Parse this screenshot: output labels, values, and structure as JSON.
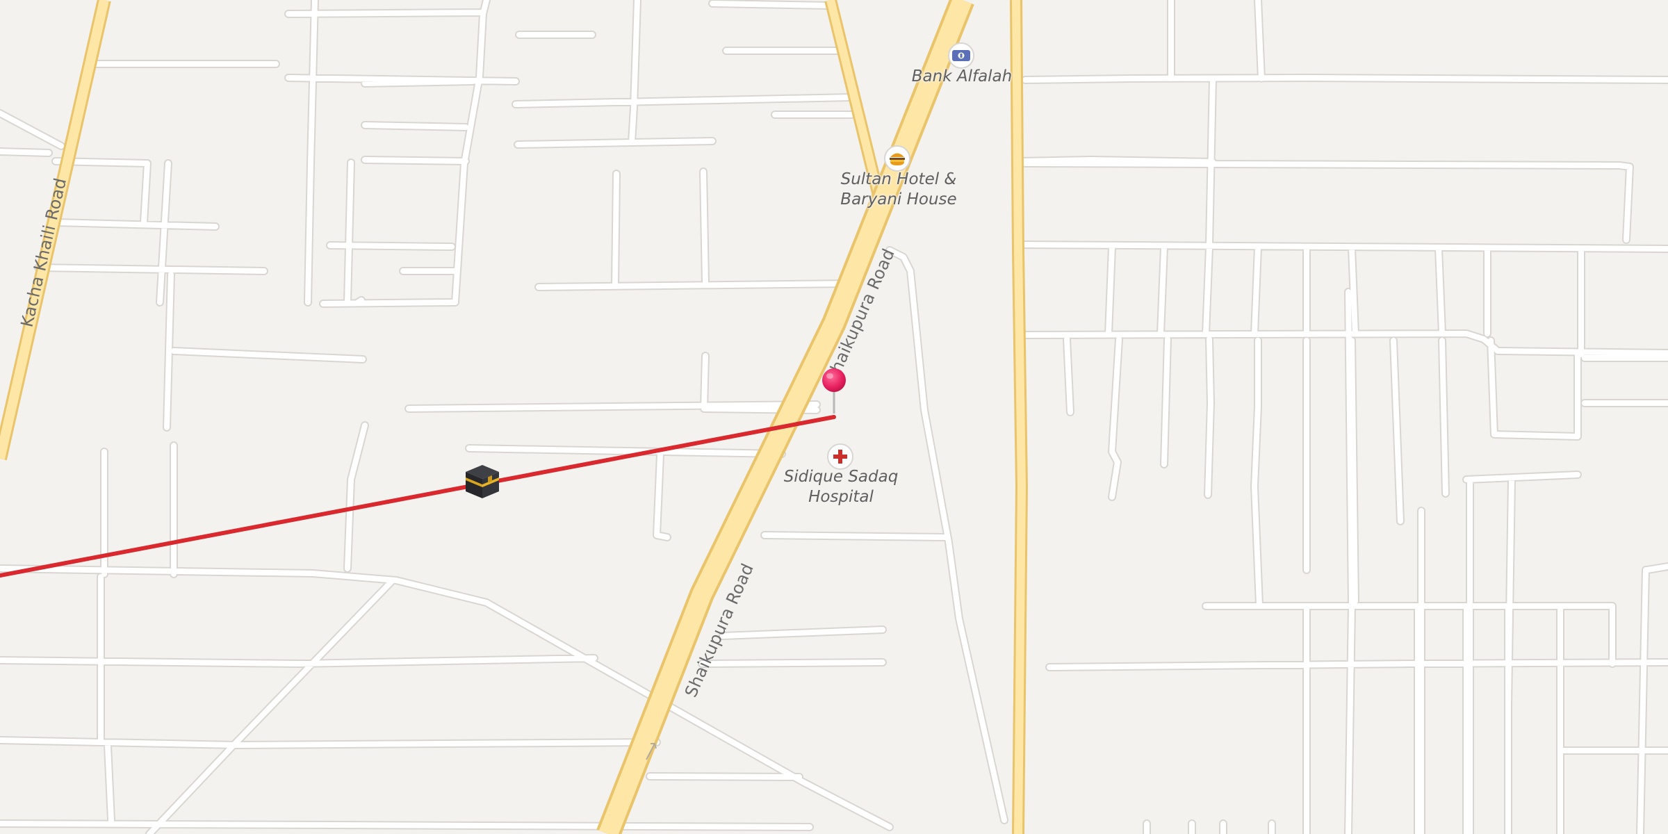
{
  "map": {
    "roads": {
      "kacha_khaili": "Kacha Khaili Road",
      "shaikupura_upper": "Shaikupura Road",
      "shaikupura_lower": "Shaikupura Road"
    },
    "pois": {
      "bank": {
        "name": "Bank Alfalah",
        "icon": "bank-icon"
      },
      "hotel": {
        "line1": "Sultan Hotel &",
        "line2": "Baryani House",
        "icon": "restaurant-icon"
      },
      "hospital": {
        "line1": "Sidique Sadaq",
        "line2": "Hospital",
        "icon": "hospital-icon"
      }
    },
    "markers": {
      "location_pin": {
        "icon": "location-pin-icon",
        "color": "#e8205f"
      },
      "qibla_target": {
        "icon": "kaaba-icon"
      }
    },
    "qibla_line_color": "#d9292f",
    "colors": {
      "background": "#f4f2ef",
      "minor_road": "#ffffff",
      "major_road_fill": "#fde6a6",
      "major_road_casing": "#e9c46a"
    }
  }
}
